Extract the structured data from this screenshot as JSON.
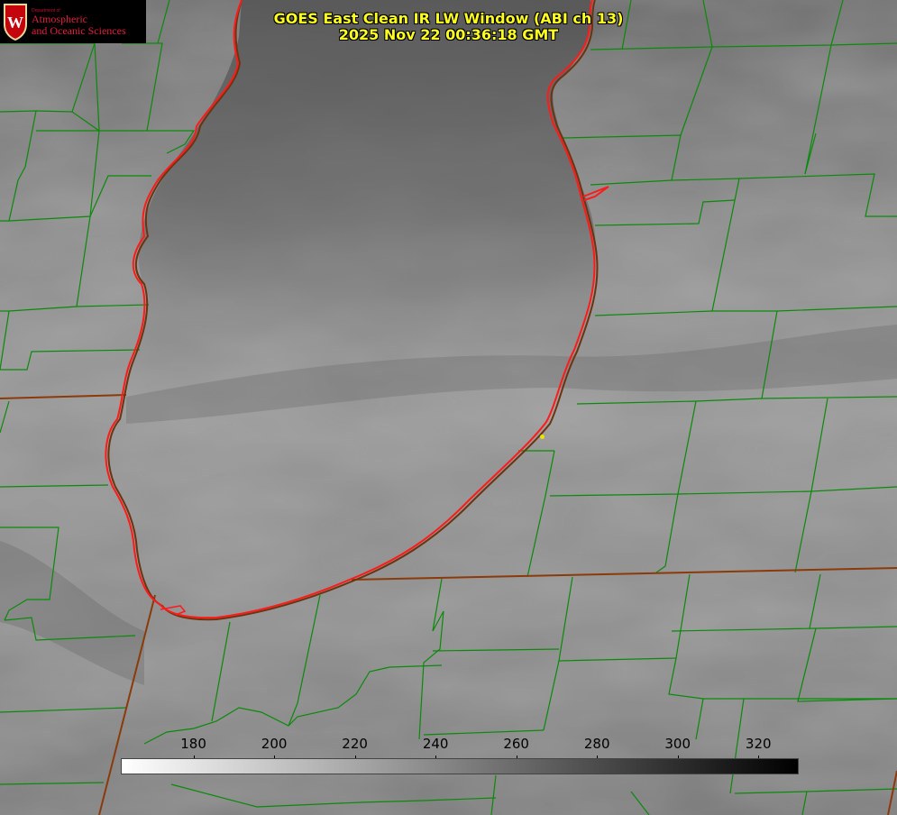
{
  "header": {
    "title": "GOES East Clean IR LW Window (ABI ch 13)",
    "timestamp": "2025 Nov 22 00:36:18 GMT"
  },
  "logo": {
    "department": "Department of",
    "line1": "Atmospheric",
    "line2": "and Oceanic Sciences"
  },
  "colorbar": {
    "ticks": [
      {
        "label": "180",
        "value": 180
      },
      {
        "label": "200",
        "value": 200
      },
      {
        "label": "220",
        "value": 220
      },
      {
        "label": "240",
        "value": 240
      },
      {
        "label": "260",
        "value": 260
      },
      {
        "label": "280",
        "value": 280
      },
      {
        "label": "300",
        "value": 300
      },
      {
        "label": "320",
        "value": 320
      }
    ],
    "range": [
      162,
      330
    ]
  },
  "colors": {
    "title": "#ffff1e",
    "county_lines": "#0a8a0a",
    "state_lines": "#8b3a0a",
    "lake_outline": "#ff1a1a"
  }
}
